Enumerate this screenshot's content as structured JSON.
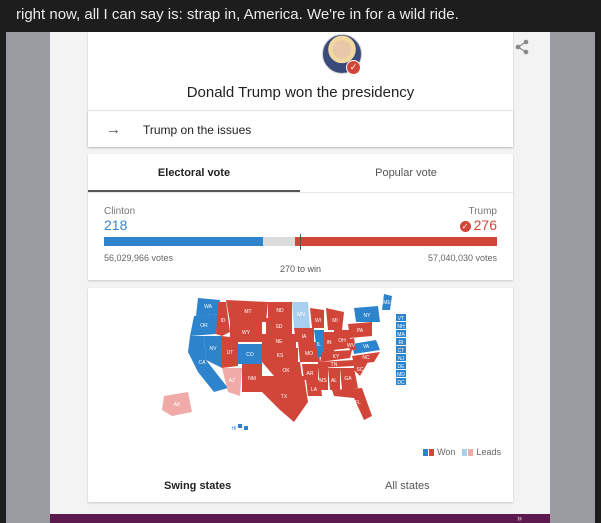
{
  "article": {
    "text": "right now, all I can say is: strap in, America. We're in for a wild ride."
  },
  "result": {
    "headline": "Donald Trump won the presidency",
    "issues_link": "Trump on the issues"
  },
  "tabs": {
    "electoral": "Electoral vote",
    "popular": "Popular vote"
  },
  "candidates": {
    "clinton": {
      "name": "Clinton",
      "electoral_votes": "218",
      "popular_votes": "56,029,966 votes",
      "color": "#2d84cc"
    },
    "trump": {
      "name": "Trump",
      "electoral_votes": "276",
      "popular_votes": "57,040,030 votes",
      "color": "#d2463a"
    }
  },
  "electoral_bar": {
    "total": 538,
    "clinton": 218,
    "trump": 276,
    "to_win_label": "270 to win"
  },
  "map": {
    "legend": {
      "won": "Won",
      "leads": "Leads"
    },
    "colors": {
      "rep_won": "#d2463a",
      "dem_won": "#2d84cc",
      "rep_leads": "#f0aaa8",
      "dem_leads": "#a8d0ee"
    },
    "state_labels": {
      "wa": "WA",
      "or": "OR",
      "ca": "CA",
      "nv": "NV",
      "id": "ID",
      "mt": "MT",
      "wy": "WY",
      "ut": "UT",
      "az": "AZ",
      "co": "CO",
      "nm": "NM",
      "nd": "ND",
      "sd": "SD",
      "ne": "NE",
      "ks": "KS",
      "ok": "OK",
      "tx": "TX",
      "mn": "MN",
      "ia": "IA",
      "mo": "MO",
      "ar": "AR",
      "la": "LA",
      "wi": "WI",
      "il": "IL",
      "ms": "MS",
      "mi": "MI",
      "in": "IN",
      "oh": "OH",
      "ky": "KY",
      "tn": "TN",
      "al": "AL",
      "ga": "GA",
      "fl": "FL",
      "sc": "SC",
      "nc": "NC",
      "va": "VA",
      "wv": "WV",
      "pa": "PA",
      "ny": "NY",
      "me": "ME",
      "ak": "AK",
      "hi": "HI",
      "vt": "VT",
      "nh": "NH",
      "ma": "MA",
      "ri": "RI",
      "ct": "CT",
      "nj": "NJ",
      "de": "DE",
      "md": "MD",
      "dc": "DC"
    }
  },
  "swing_tabs": {
    "swing": "Swing states",
    "all": "All states"
  },
  "icons": {
    "share": "share-icon",
    "arrow": "arrow-right-icon",
    "check": "check-circle-icon",
    "avatar": "candidate-avatar"
  }
}
